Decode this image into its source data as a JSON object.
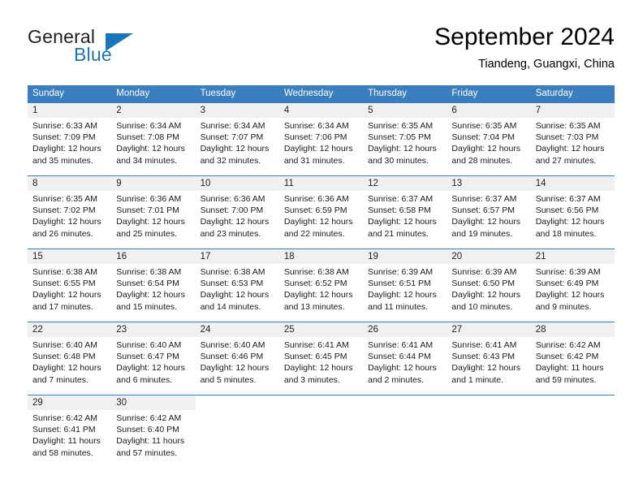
{
  "brand": {
    "name_part1": "General",
    "name_part2": "Blue",
    "accent_color": "#1b75bb"
  },
  "header": {
    "title": "September 2024",
    "location": "Tiandeng, Guangxi, China"
  },
  "calendar": {
    "header_color": "#3a7ebf",
    "weekday_headers": [
      "Sunday",
      "Monday",
      "Tuesday",
      "Wednesday",
      "Thursday",
      "Friday",
      "Saturday"
    ],
    "weeks": [
      [
        {
          "day": "1",
          "sunrise": "Sunrise: 6:33 AM",
          "sunset": "Sunset: 7:09 PM",
          "daylight1": "Daylight: 12 hours",
          "daylight2": "and 35 minutes."
        },
        {
          "day": "2",
          "sunrise": "Sunrise: 6:34 AM",
          "sunset": "Sunset: 7:08 PM",
          "daylight1": "Daylight: 12 hours",
          "daylight2": "and 34 minutes."
        },
        {
          "day": "3",
          "sunrise": "Sunrise: 6:34 AM",
          "sunset": "Sunset: 7:07 PM",
          "daylight1": "Daylight: 12 hours",
          "daylight2": "and 32 minutes."
        },
        {
          "day": "4",
          "sunrise": "Sunrise: 6:34 AM",
          "sunset": "Sunset: 7:06 PM",
          "daylight1": "Daylight: 12 hours",
          "daylight2": "and 31 minutes."
        },
        {
          "day": "5",
          "sunrise": "Sunrise: 6:35 AM",
          "sunset": "Sunset: 7:05 PM",
          "daylight1": "Daylight: 12 hours",
          "daylight2": "and 30 minutes."
        },
        {
          "day": "6",
          "sunrise": "Sunrise: 6:35 AM",
          "sunset": "Sunset: 7:04 PM",
          "daylight1": "Daylight: 12 hours",
          "daylight2": "and 28 minutes."
        },
        {
          "day": "7",
          "sunrise": "Sunrise: 6:35 AM",
          "sunset": "Sunset: 7:03 PM",
          "daylight1": "Daylight: 12 hours",
          "daylight2": "and 27 minutes."
        }
      ],
      [
        {
          "day": "8",
          "sunrise": "Sunrise: 6:35 AM",
          "sunset": "Sunset: 7:02 PM",
          "daylight1": "Daylight: 12 hours",
          "daylight2": "and 26 minutes."
        },
        {
          "day": "9",
          "sunrise": "Sunrise: 6:36 AM",
          "sunset": "Sunset: 7:01 PM",
          "daylight1": "Daylight: 12 hours",
          "daylight2": "and 25 minutes."
        },
        {
          "day": "10",
          "sunrise": "Sunrise: 6:36 AM",
          "sunset": "Sunset: 7:00 PM",
          "daylight1": "Daylight: 12 hours",
          "daylight2": "and 23 minutes."
        },
        {
          "day": "11",
          "sunrise": "Sunrise: 6:36 AM",
          "sunset": "Sunset: 6:59 PM",
          "daylight1": "Daylight: 12 hours",
          "daylight2": "and 22 minutes."
        },
        {
          "day": "12",
          "sunrise": "Sunrise: 6:37 AM",
          "sunset": "Sunset: 6:58 PM",
          "daylight1": "Daylight: 12 hours",
          "daylight2": "and 21 minutes."
        },
        {
          "day": "13",
          "sunrise": "Sunrise: 6:37 AM",
          "sunset": "Sunset: 6:57 PM",
          "daylight1": "Daylight: 12 hours",
          "daylight2": "and 19 minutes."
        },
        {
          "day": "14",
          "sunrise": "Sunrise: 6:37 AM",
          "sunset": "Sunset: 6:56 PM",
          "daylight1": "Daylight: 12 hours",
          "daylight2": "and 18 minutes."
        }
      ],
      [
        {
          "day": "15",
          "sunrise": "Sunrise: 6:38 AM",
          "sunset": "Sunset: 6:55 PM",
          "daylight1": "Daylight: 12 hours",
          "daylight2": "and 17 minutes."
        },
        {
          "day": "16",
          "sunrise": "Sunrise: 6:38 AM",
          "sunset": "Sunset: 6:54 PM",
          "daylight1": "Daylight: 12 hours",
          "daylight2": "and 15 minutes."
        },
        {
          "day": "17",
          "sunrise": "Sunrise: 6:38 AM",
          "sunset": "Sunset: 6:53 PM",
          "daylight1": "Daylight: 12 hours",
          "daylight2": "and 14 minutes."
        },
        {
          "day": "18",
          "sunrise": "Sunrise: 6:38 AM",
          "sunset": "Sunset: 6:52 PM",
          "daylight1": "Daylight: 12 hours",
          "daylight2": "and 13 minutes."
        },
        {
          "day": "19",
          "sunrise": "Sunrise: 6:39 AM",
          "sunset": "Sunset: 6:51 PM",
          "daylight1": "Daylight: 12 hours",
          "daylight2": "and 11 minutes."
        },
        {
          "day": "20",
          "sunrise": "Sunrise: 6:39 AM",
          "sunset": "Sunset: 6:50 PM",
          "daylight1": "Daylight: 12 hours",
          "daylight2": "and 10 minutes."
        },
        {
          "day": "21",
          "sunrise": "Sunrise: 6:39 AM",
          "sunset": "Sunset: 6:49 PM",
          "daylight1": "Daylight: 12 hours",
          "daylight2": "and 9 minutes."
        }
      ],
      [
        {
          "day": "22",
          "sunrise": "Sunrise: 6:40 AM",
          "sunset": "Sunset: 6:48 PM",
          "daylight1": "Daylight: 12 hours",
          "daylight2": "and 7 minutes."
        },
        {
          "day": "23",
          "sunrise": "Sunrise: 6:40 AM",
          "sunset": "Sunset: 6:47 PM",
          "daylight1": "Daylight: 12 hours",
          "daylight2": "and 6 minutes."
        },
        {
          "day": "24",
          "sunrise": "Sunrise: 6:40 AM",
          "sunset": "Sunset: 6:46 PM",
          "daylight1": "Daylight: 12 hours",
          "daylight2": "and 5 minutes."
        },
        {
          "day": "25",
          "sunrise": "Sunrise: 6:41 AM",
          "sunset": "Sunset: 6:45 PM",
          "daylight1": "Daylight: 12 hours",
          "daylight2": "and 3 minutes."
        },
        {
          "day": "26",
          "sunrise": "Sunrise: 6:41 AM",
          "sunset": "Sunset: 6:44 PM",
          "daylight1": "Daylight: 12 hours",
          "daylight2": "and 2 minutes."
        },
        {
          "day": "27",
          "sunrise": "Sunrise: 6:41 AM",
          "sunset": "Sunset: 6:43 PM",
          "daylight1": "Daylight: 12 hours",
          "daylight2": "and 1 minute."
        },
        {
          "day": "28",
          "sunrise": "Sunrise: 6:42 AM",
          "sunset": "Sunset: 6:42 PM",
          "daylight1": "Daylight: 11 hours",
          "daylight2": "and 59 minutes."
        }
      ],
      [
        {
          "day": "29",
          "sunrise": "Sunrise: 6:42 AM",
          "sunset": "Sunset: 6:41 PM",
          "daylight1": "Daylight: 11 hours",
          "daylight2": "and 58 minutes."
        },
        {
          "day": "30",
          "sunrise": "Sunrise: 6:42 AM",
          "sunset": "Sunset: 6:40 PM",
          "daylight1": "Daylight: 11 hours",
          "daylight2": "and 57 minutes."
        },
        {
          "day": "",
          "sunrise": "",
          "sunset": "",
          "daylight1": "",
          "daylight2": ""
        },
        {
          "day": "",
          "sunrise": "",
          "sunset": "",
          "daylight1": "",
          "daylight2": ""
        },
        {
          "day": "",
          "sunrise": "",
          "sunset": "",
          "daylight1": "",
          "daylight2": ""
        },
        {
          "day": "",
          "sunrise": "",
          "sunset": "",
          "daylight1": "",
          "daylight2": ""
        },
        {
          "day": "",
          "sunrise": "",
          "sunset": "",
          "daylight1": "",
          "daylight2": ""
        }
      ]
    ]
  }
}
